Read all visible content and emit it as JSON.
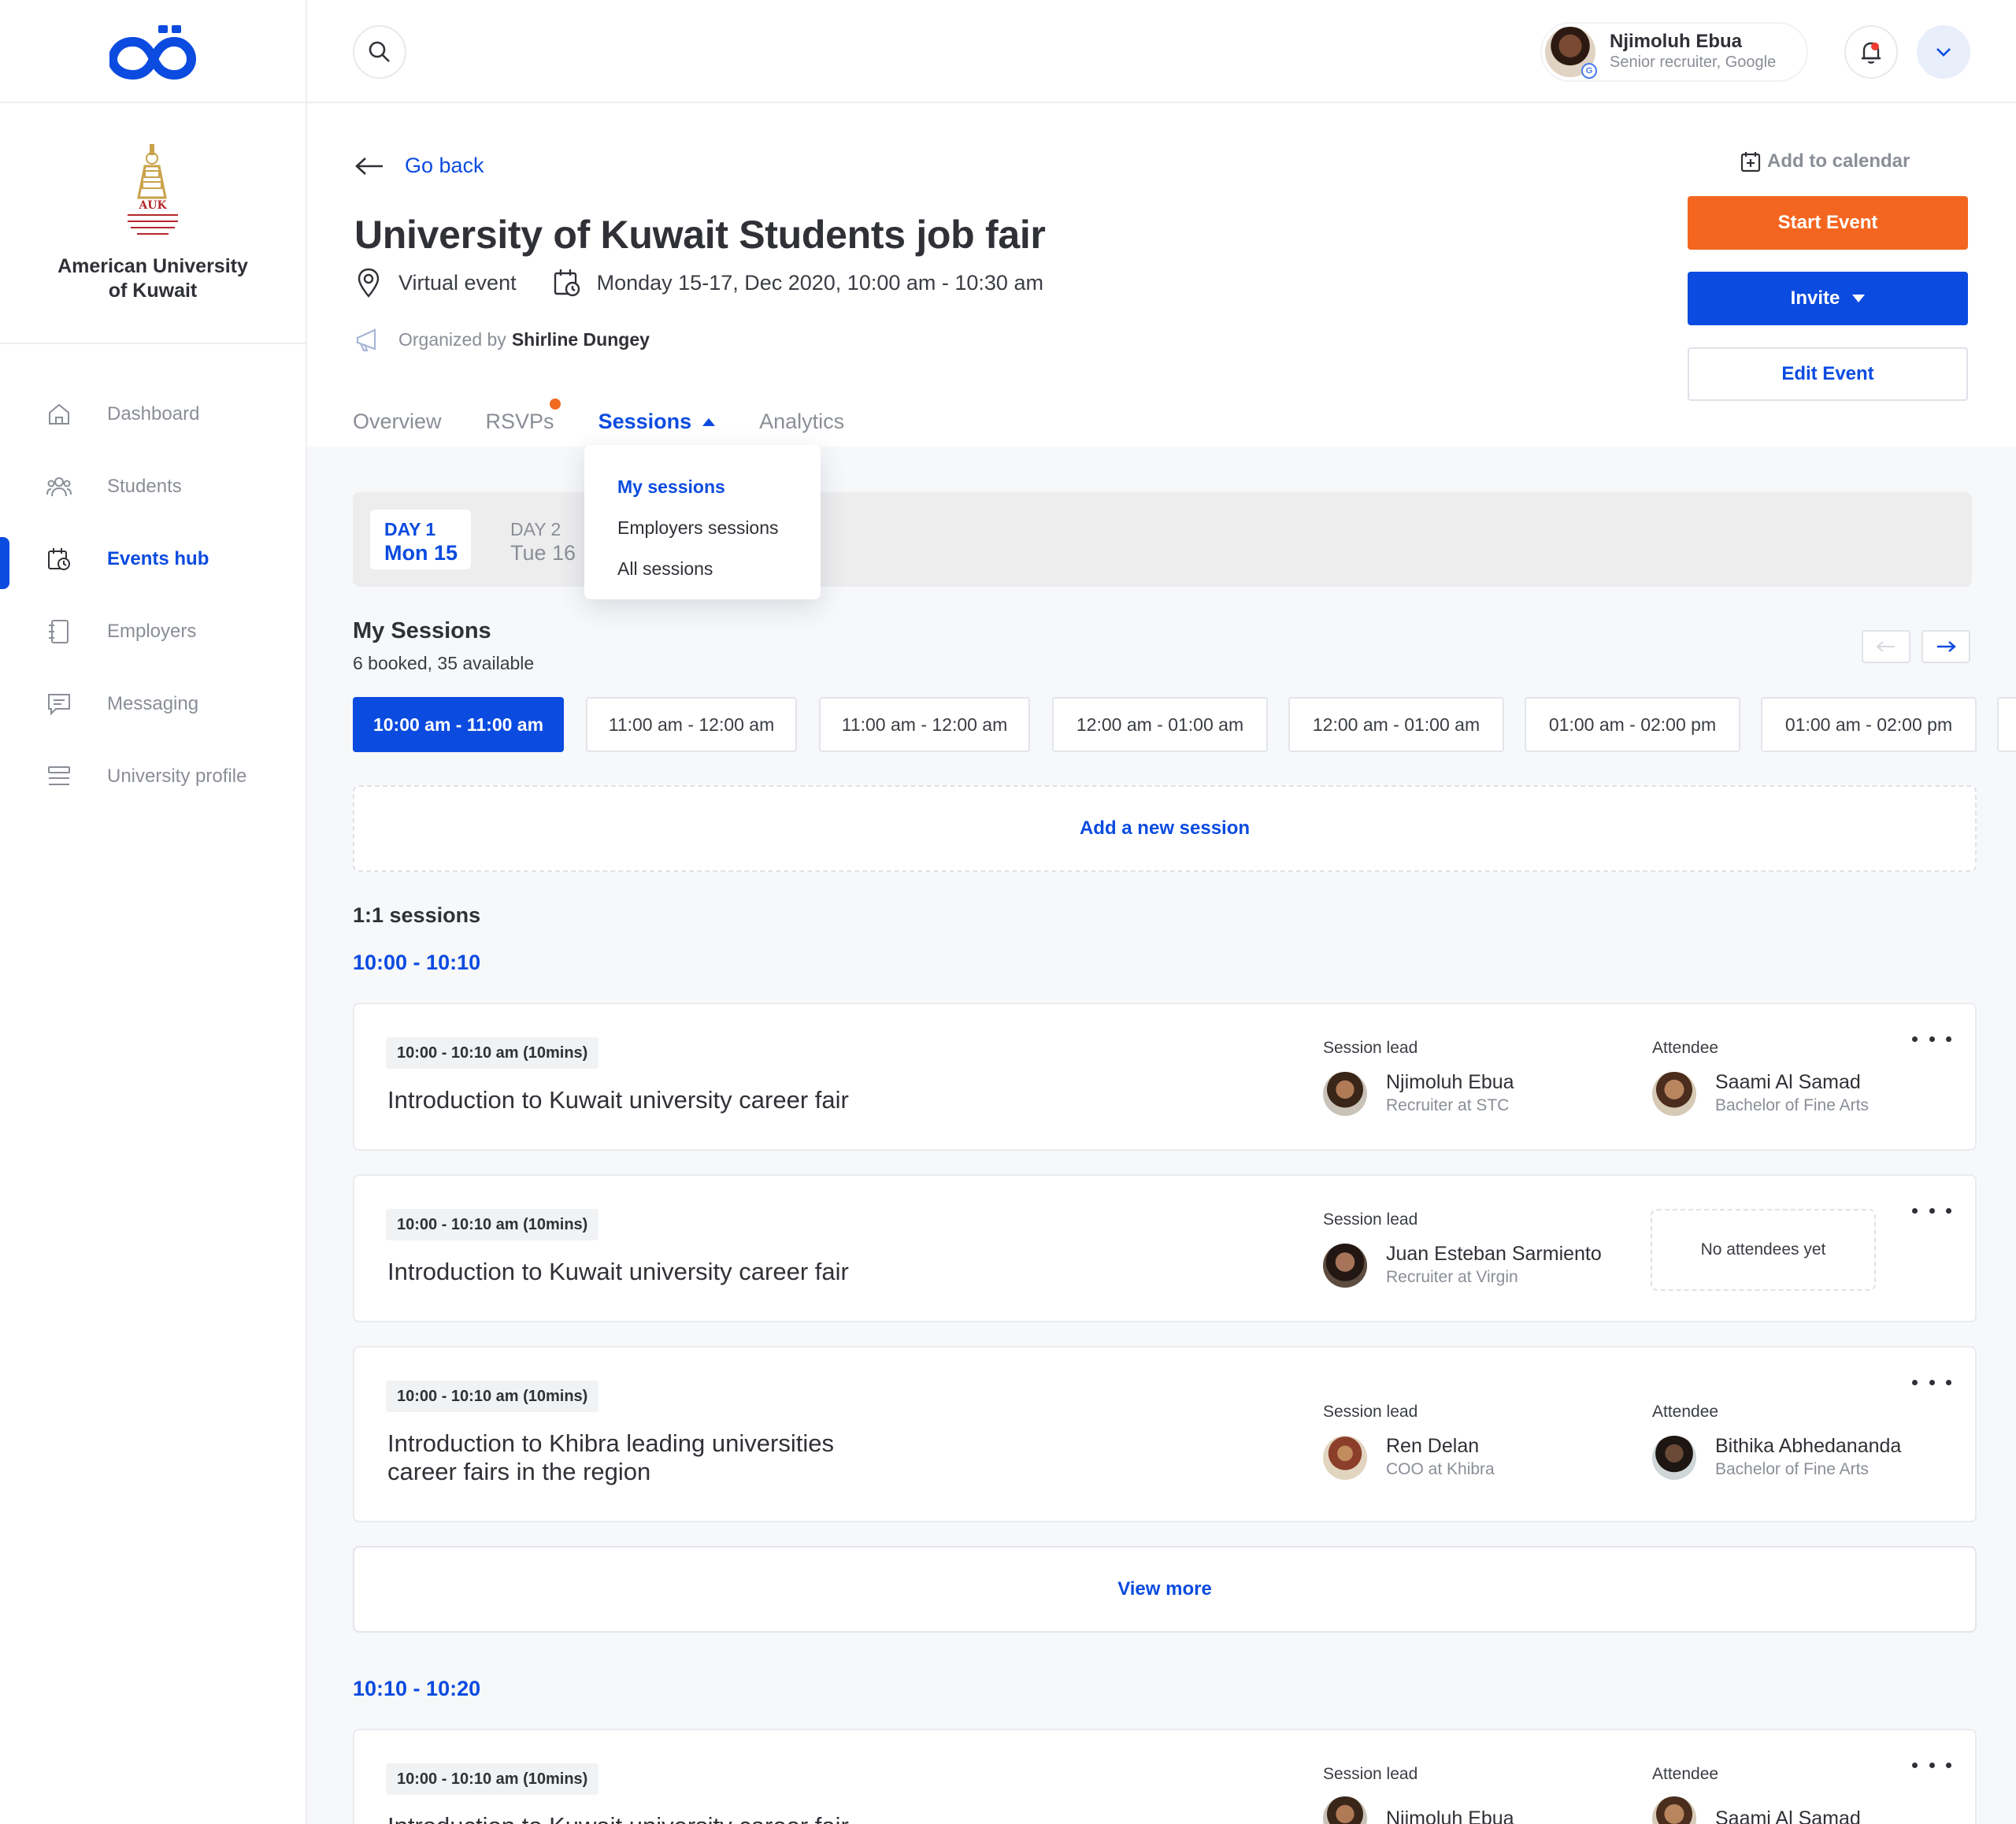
{
  "sidebar": {
    "university": {
      "name": "American University of Kuwait",
      "logo_text": "AUK"
    },
    "nav": [
      {
        "label": "Dashboard",
        "icon": "home-icon"
      },
      {
        "label": "Students",
        "icon": "users-icon"
      },
      {
        "label": "Events hub",
        "icon": "calendar-clock-icon",
        "active": true
      },
      {
        "label": "Employers",
        "icon": "address-book-icon"
      },
      {
        "label": "Messaging",
        "icon": "chat-icon"
      },
      {
        "label": "University profile",
        "icon": "list-icon"
      }
    ]
  },
  "topbar": {
    "user": {
      "name": "Njimoluh Ebua",
      "role": "Senior recruiter, Google",
      "badge": "G"
    }
  },
  "event": {
    "go_back": "Go back",
    "title": "University of Kuwait Students job fair",
    "location": "Virtual event",
    "datetime": "Monday 15-17, Dec 2020, 10:00 am - 10:30 am",
    "organized_by_prefix": "Organized by",
    "organizer": "Shirline Dungey",
    "add_to_calendar": "Add to calendar",
    "actions": {
      "start": "Start Event",
      "invite": "Invite",
      "edit": "Edit Event"
    },
    "tabs": [
      {
        "label": "Overview"
      },
      {
        "label": "RSVPs",
        "has_badge": true
      },
      {
        "label": "Sessions",
        "active": true
      },
      {
        "label": "Analytics"
      }
    ]
  },
  "sessions_menu": {
    "items": [
      {
        "label": "My sessions",
        "active": true
      },
      {
        "label": "Employers sessions"
      },
      {
        "label": "All sessions"
      }
    ]
  },
  "days": [
    {
      "label": "DAY 1",
      "date": "Mon 15",
      "active": true
    },
    {
      "label": "DAY 2",
      "date": "Tue 16"
    }
  ],
  "my_sessions": {
    "title": "My Sessions",
    "subtitle": "6 booked, 35 available",
    "slots": [
      {
        "label": "10:00 am - 11:00 am",
        "active": true
      },
      {
        "label": "11:00 am - 12:00 am"
      },
      {
        "label": "11:00 am - 12:00 am"
      },
      {
        "label": "12:00 am - 01:00 am"
      },
      {
        "label": "12:00 am - 01:00 am"
      },
      {
        "label": "01:00 am - 02:00 pm"
      },
      {
        "label": "01:00 am - 02:00 pm"
      }
    ],
    "add_new": "Add a new session"
  },
  "one_on_one": {
    "heading": "1:1 sessions",
    "groups": [
      {
        "time": "10:00 - 10:10",
        "cards": [
          {
            "time": "10:00 - 10:10 am (10mins)",
            "title": "Introduction to Kuwait university career fair",
            "lead_label": "Session lead",
            "lead": {
              "name": "Njimoluh Ebua",
              "role": "Recruiter at STC"
            },
            "attendee_label": "Attendee",
            "attendee": {
              "name": "Saami Al Samad",
              "role": "Bachelor of Fine Arts"
            }
          },
          {
            "time": "10:00 - 10:10 am (10mins)",
            "title": "Introduction to Kuwait university career fair",
            "lead_label": "Session lead",
            "lead": {
              "name": "Juan Esteban Sarmiento",
              "role": "Recruiter at Virgin"
            },
            "no_attendees": "No attendees yet"
          },
          {
            "time": "10:00 - 10:10 am (10mins)",
            "title": "Introduction to Khibra leading universities career fairs in the region",
            "lead_label": "Session lead",
            "lead": {
              "name": "Ren Delan",
              "role": "COO at Khibra"
            },
            "attendee_label": "Attendee",
            "attendee": {
              "name": "Bithika Abhedananda",
              "role": "Bachelor of Fine Arts"
            }
          }
        ],
        "view_more": "View more"
      },
      {
        "time": "10:10 - 10:20",
        "cards": [
          {
            "time": "10:00 - 10:10 am (10mins)",
            "title": "Introduction to Kuwait university career fair",
            "lead_label": "Session lead",
            "lead": {
              "name": "Njimoluh Ebua"
            },
            "attendee_label": "Attendee",
            "attendee": {
              "name": "Saami Al Samad"
            }
          }
        ]
      }
    ]
  },
  "colors": {
    "primary": "#0b4be0",
    "accent": "#f4661f",
    "notification": "#ef3b32"
  }
}
